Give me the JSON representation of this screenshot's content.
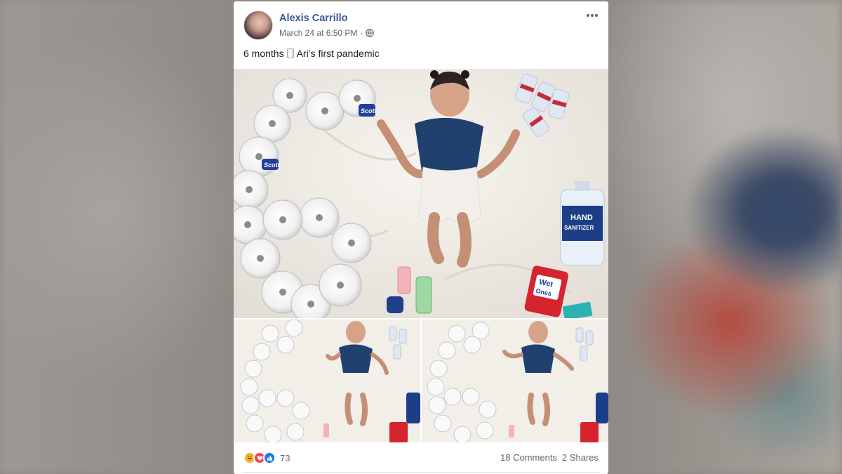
{
  "post": {
    "author": "Alexis Carrillo",
    "timestamp": "March 24 at 6:50 PM",
    "separator": "·",
    "privacy_icon": "globe-icon",
    "caption_before": "6 months",
    "caption_icon": "toilet-paper-emoji",
    "caption_after": "Ari’s first pandemic",
    "reactions": [
      "haha-icon",
      "love-icon",
      "like-icon"
    ],
    "reaction_count": "73",
    "comments": "18 Comments",
    "shares": "2 Shares",
    "photo_labels": {
      "scott": "Scott",
      "hand": "HAND",
      "sanitizer": "SANITIZER",
      "wet": "Wet",
      "ones": "Ones"
    }
  },
  "colors": {
    "link": "#385898",
    "secondary_text": "#606770",
    "like": "#1877f2",
    "love": "#f33e58",
    "haha": "#f7b125"
  }
}
